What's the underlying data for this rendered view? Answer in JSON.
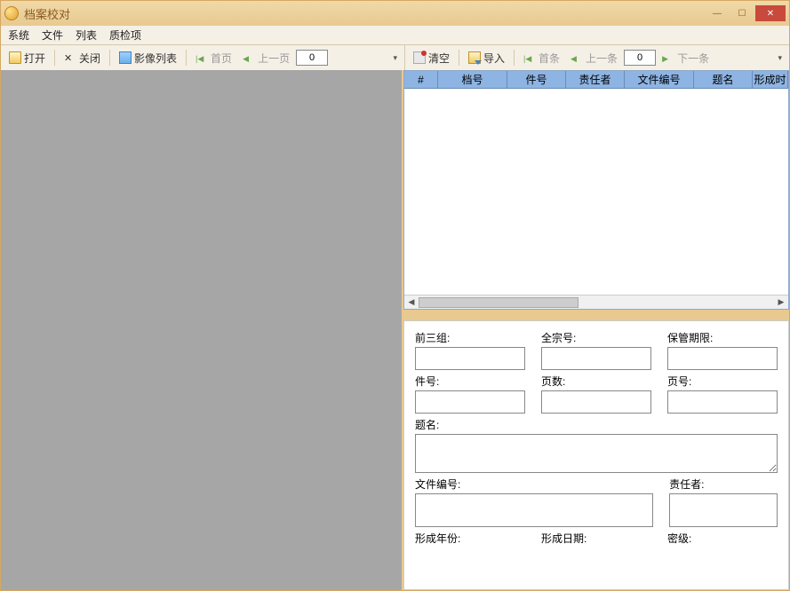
{
  "title": "档案校对",
  "menu": {
    "system": "系统",
    "file": "文件",
    "list": "列表",
    "qc": "质检项"
  },
  "toolbar_left": {
    "open": "打开",
    "close": "关闭",
    "image_list": "影像列表",
    "first": "首页",
    "prev": "上一页",
    "page": "0"
  },
  "toolbar_right": {
    "clear": "清空",
    "import": "导入",
    "first": "首条",
    "prev": "上一条",
    "next": "下一条",
    "index": "0"
  },
  "grid": {
    "columns": [
      "#",
      "档号",
      "件号",
      "责任者",
      "文件编号",
      "题名",
      "形成时"
    ],
    "widths": [
      38,
      78,
      66,
      66,
      78,
      66,
      40
    ]
  },
  "form": {
    "row1": [
      {
        "label": "前三组:",
        "value": ""
      },
      {
        "label": "全宗号:",
        "value": ""
      },
      {
        "label": "保管期限:",
        "value": ""
      }
    ],
    "row2": [
      {
        "label": "件号:",
        "value": ""
      },
      {
        "label": "页数:",
        "value": ""
      },
      {
        "label": "页号:",
        "value": ""
      }
    ],
    "row3": [
      {
        "label": "题名:",
        "value": ""
      }
    ],
    "row4": [
      {
        "label": "文件编号:",
        "value": ""
      },
      {
        "label": "责任者:",
        "value": ""
      }
    ],
    "row5": [
      {
        "label": "形成年份:",
        "value": ""
      },
      {
        "label": "形成日期:",
        "value": ""
      },
      {
        "label": "密级:",
        "value": ""
      }
    ]
  }
}
